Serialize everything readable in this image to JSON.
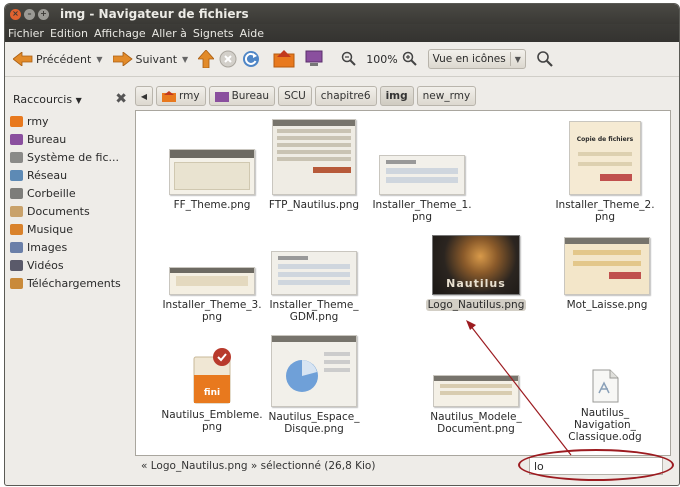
{
  "window": {
    "title": "img - Navigateur de fichiers"
  },
  "menubar": {
    "items": [
      "Fichier",
      "Edition",
      "Affichage",
      "Aller à",
      "Signets",
      "Aide"
    ]
  },
  "toolbar": {
    "back_label": "Précédent",
    "forward_label": "Suivant",
    "zoom_level": "100%",
    "view_mode": "Vue en icônes"
  },
  "sidebar": {
    "header": "Raccourcis",
    "items": [
      {
        "label": "rmy",
        "color": "#e8791e"
      },
      {
        "label": "Bureau",
        "color": "#8a4f9e"
      },
      {
        "label": "Système de fic...",
        "color": "#8a8a88"
      },
      {
        "label": "Réseau",
        "color": "#5d8ab5"
      },
      {
        "label": "Corbeille",
        "color": "#7d7d7a"
      },
      {
        "label": "Documents",
        "color": "#c9a26b"
      },
      {
        "label": "Musique",
        "color": "#d9822b"
      },
      {
        "label": "Images",
        "color": "#6a7fa8"
      },
      {
        "label": "Vidéos",
        "color": "#5a5a6a"
      },
      {
        "label": "Téléchargements",
        "color": "#c98a3a"
      }
    ]
  },
  "pathbar": {
    "segments": [
      "rmy",
      "Bureau",
      "SCU",
      "chapitre6",
      "img",
      "new_rmy"
    ],
    "active": "img"
  },
  "files": [
    {
      "line1": "FF_Theme.png",
      "line2": ""
    },
    {
      "line1": "FTP_Nautilus.png",
      "line2": ""
    },
    {
      "line1": "Installer_Theme_1.",
      "line2": "png"
    },
    {
      "line1": "Installer_Theme_2.",
      "line2": "png"
    },
    {
      "line1": "Installer_Theme_3.",
      "line2": "png"
    },
    {
      "line1": "Installer_Theme_",
      "line2": "GDM.png"
    },
    {
      "line1": "Logo_Nautilus.png",
      "line2": ""
    },
    {
      "line1": "Mot_Laisse.png",
      "line2": ""
    },
    {
      "line1": "Nautilus_Embleme.",
      "line2": "png"
    },
    {
      "line1": "Nautilus_Espace_",
      "line2": "Disque.png"
    },
    {
      "line1": "Nautilus_Modele_",
      "line2": "Document.png"
    },
    {
      "line1": "Nautilus_",
      "line2": "Navigation_",
      "line3": "Classique.odg"
    }
  ],
  "thumbnails": {
    "copy_dialog_title": "Copie de fichiers",
    "nautilus_logo_text": "Nautilus",
    "emblem_badge_text": "fini"
  },
  "status": {
    "text": "« Logo_Nautilus.png » sélectionné (26,8 Kio)"
  },
  "search": {
    "value": "lo"
  },
  "annotation": {
    "color": "#9c1b20"
  }
}
